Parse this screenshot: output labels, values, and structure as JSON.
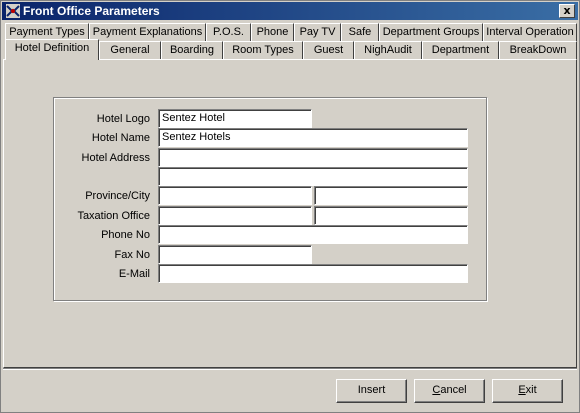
{
  "window": {
    "title": "Front Office Parameters",
    "close_glyph": "x",
    "icon": "app-icon"
  },
  "tabs_row1": [
    {
      "label": "Payment Types"
    },
    {
      "label": "Payment Explanations"
    },
    {
      "label": "P.O.S."
    },
    {
      "label": "Phone"
    },
    {
      "label": "Pay TV"
    },
    {
      "label": "Safe"
    },
    {
      "label": "Department Groups"
    },
    {
      "label": "Interval Operation"
    }
  ],
  "tabs_row2": [
    {
      "label": "Hotel Definition",
      "active": true
    },
    {
      "label": "General"
    },
    {
      "label": "Boarding"
    },
    {
      "label": "Room Types"
    },
    {
      "label": "Guest"
    },
    {
      "label": "NighAudit"
    },
    {
      "label": "Department"
    },
    {
      "label": "BreakDown"
    }
  ],
  "form": {
    "hotel_logo": {
      "label": "Hotel Logo",
      "value": "Sentez Hotel"
    },
    "hotel_name": {
      "label": "Hotel Name",
      "value": "Sentez Hotels"
    },
    "hotel_address": {
      "label": "Hotel Address",
      "value_line1": "",
      "value_line2": ""
    },
    "province_city": {
      "label": "Province/City",
      "province": "",
      "city": ""
    },
    "taxation_office": {
      "label": "Taxation Office",
      "office": "",
      "number": ""
    },
    "phone_no": {
      "label": "Phone No",
      "value": ""
    },
    "fax_no": {
      "label": "Fax No",
      "value": ""
    },
    "email": {
      "label": "E-Mail",
      "value": ""
    }
  },
  "buttons": {
    "insert": "Insert",
    "cancel_first": "C",
    "cancel_rest": "ancel",
    "exit_first": "E",
    "exit_rest": "xit"
  }
}
